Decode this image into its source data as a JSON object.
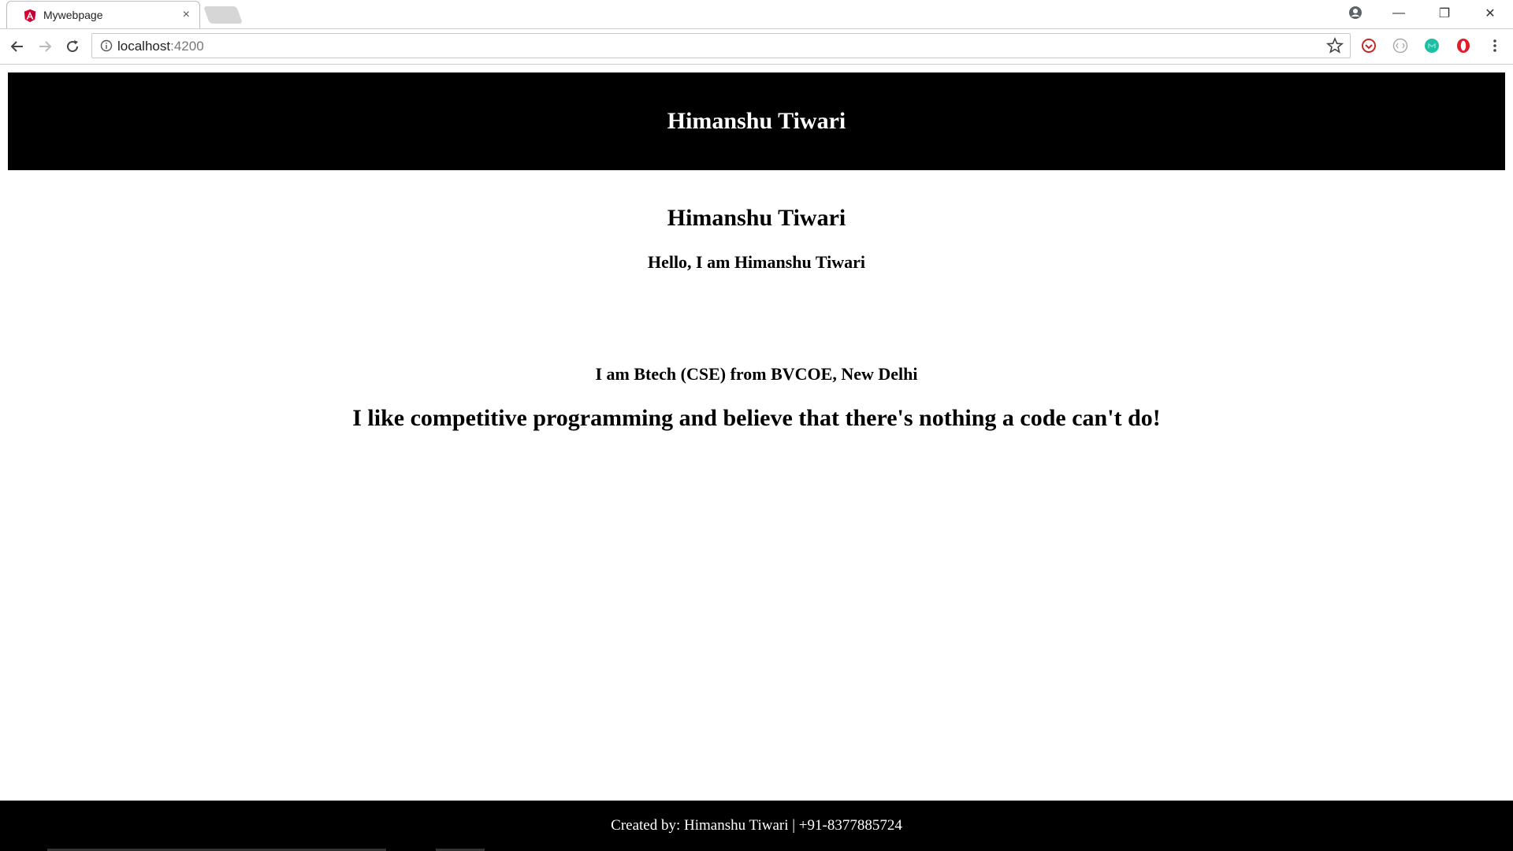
{
  "browser": {
    "tab": {
      "title": "Mywebpage",
      "close_glyph": "×",
      "favicon": "angular-icon"
    },
    "address_bar": {
      "host": "localhost",
      "port": ":4200"
    },
    "window_controls": {
      "minimize": "—",
      "restore": "❐",
      "close": "✕"
    },
    "icons": [
      "back-icon",
      "forward-icon",
      "reload-icon",
      "info-icon",
      "star-icon",
      "profile-icon",
      "menu-icon"
    ]
  },
  "page": {
    "header_title": "Himanshu Tiwari",
    "name": "Himanshu Tiwari",
    "greeting": "Hello, I am Himanshu Tiwari",
    "education": "I am Btech (CSE) from BVCOE, New Delhi",
    "tagline": "I like competitive programming and believe that there's nothing a code can't do!",
    "footer": "Created by: Himanshu Tiwari | +91-8377885724"
  },
  "colors": {
    "header_bg": "#000000",
    "footer_bg": "#000000",
    "angular_red": "#dd0031"
  }
}
